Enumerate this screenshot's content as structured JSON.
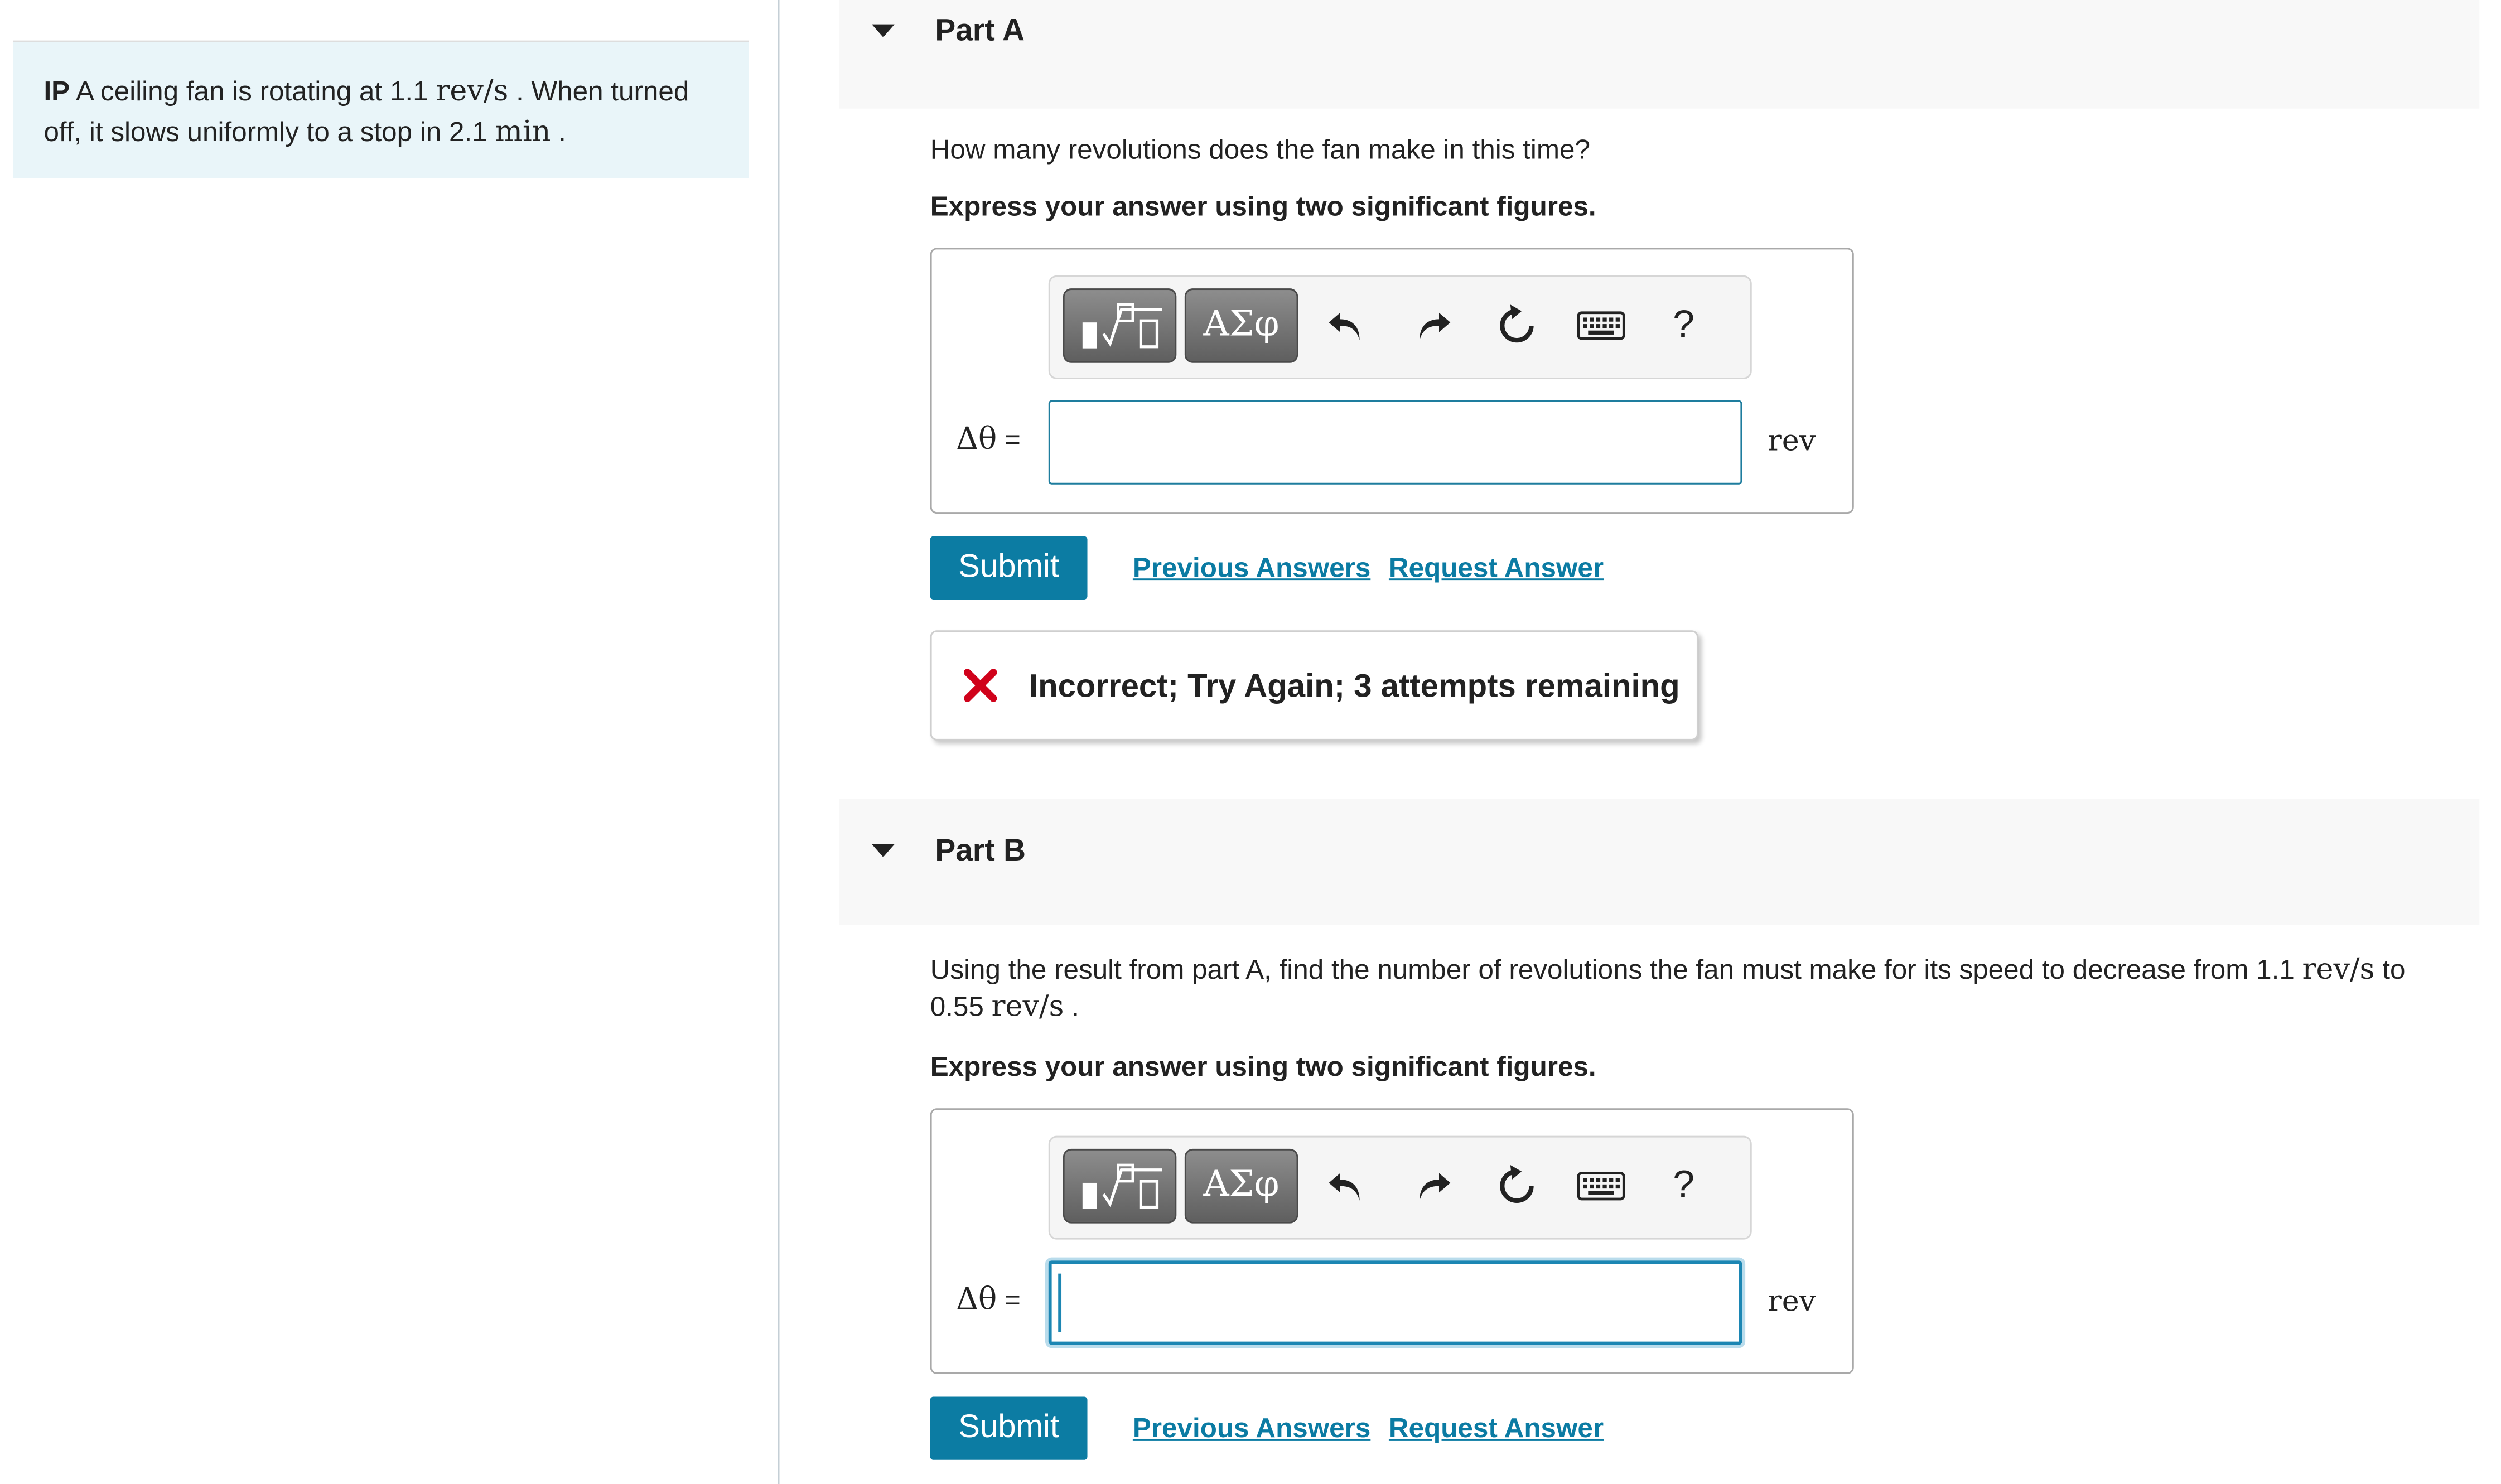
{
  "problem": {
    "prefix": "IP",
    "text_1": " A ceiling fan is rotating at 1.1 ",
    "unit_rev_s": "rev/s",
    "text_2": " . When turned off, it slows uniformly to a stop in 2.1 ",
    "unit_min": "min",
    "text_3": " ."
  },
  "toolbar": {
    "greek_label": "ΑΣφ",
    "help_label": "?",
    "icons": [
      "templates-icon",
      "greek-symbols-icon",
      "undo-icon",
      "redo-icon",
      "reset-icon",
      "keyboard-icon",
      "help-icon"
    ]
  },
  "parts": [
    {
      "title": "Part A",
      "question": "How many revolutions does the fan make in this time?",
      "instruction": "Express your answer using two significant figures.",
      "variable": "Δθ",
      "equals": " =",
      "input_value": "",
      "unit": "rev",
      "submit_label": "Submit",
      "previous_answers_label": "Previous Answers",
      "request_answer_label": "Request Answer",
      "feedback": "Incorrect; Try Again; 3 attempts remaining"
    },
    {
      "title": "Part B",
      "question_1": "Using the result from part A, find the number of revolutions the fan must make for its speed to decrease from 1.1 ",
      "question_unit_1": "rev/s",
      "question_2": " to 0.55 ",
      "question_unit_2": "rev/s",
      "question_3": " .",
      "instruction": "Express your answer using two significant figures.",
      "variable": "Δθ",
      "equals": " =",
      "input_value": "",
      "unit": "rev",
      "submit_label": "Submit",
      "previous_answers_label": "Previous Answers",
      "request_answer_label": "Request Answer"
    }
  ],
  "colors": {
    "accent": "#0c7ca3",
    "link": "#0b7ba3",
    "problem_bg": "#e9f5f9",
    "error": "#d0021b"
  }
}
